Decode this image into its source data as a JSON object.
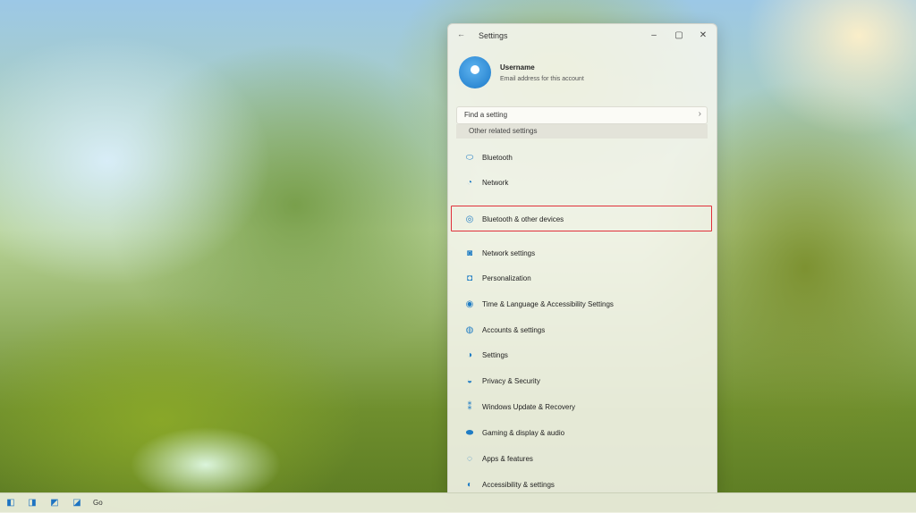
{
  "window": {
    "title": "Settings",
    "back_icon": "back-arrow-icon",
    "controls": [
      "minimize",
      "maximize",
      "close"
    ],
    "control_glyphs": {
      "minimize": "–",
      "maximize": "▢",
      "close": "✕"
    }
  },
  "profile": {
    "name": "Username",
    "email": "Email address for this account",
    "avatar_color": "#1a78c8"
  },
  "find_setting": {
    "label": "Find a setting",
    "chevron": "›"
  },
  "other_settings": {
    "label": "Other related settings"
  },
  "nav_items": [
    {
      "label": "Bluetooth",
      "icon": "bluetooth-icon",
      "glyph": "⬭"
    },
    {
      "label": "Network",
      "icon": "network-icon",
      "glyph": "◔"
    },
    {
      "label": "Bluetooth & other devices",
      "icon": "devices-icon",
      "glyph": "◎",
      "highlighted": true
    },
    {
      "label": "Network settings",
      "icon": "network-settings-icon",
      "glyph": "◙"
    },
    {
      "label": "Personalization",
      "icon": "personalization-icon",
      "glyph": "◘"
    },
    {
      "label": "Time & Language & Accessibility Settings",
      "icon": "time-icon",
      "glyph": "◉"
    },
    {
      "label": "Accounts & settings",
      "icon": "accounts-icon",
      "glyph": "◍"
    },
    {
      "label": "Settings",
      "icon": "settings-icon",
      "glyph": "◑"
    },
    {
      "label": "Privacy & Security",
      "icon": "privacy-icon",
      "glyph": "◒"
    },
    {
      "label": "Windows Update & Recovery",
      "icon": "update-icon",
      "glyph": "⁑"
    },
    {
      "label": "Gaming & display & audio",
      "icon": "gaming-icon",
      "glyph": "⬬"
    },
    {
      "label": "Apps & features",
      "icon": "apps-icon",
      "glyph": "◌"
    },
    {
      "label": "Accessibility & settings",
      "icon": "accessibility-icon",
      "glyph": "◐"
    }
  ],
  "highlight_color": "#e0303a",
  "taskbar": {
    "apps": [
      {
        "icon": "start-icon",
        "glyph": "◧"
      },
      {
        "icon": "file-explorer-icon",
        "glyph": "◨"
      },
      {
        "icon": "folder-icon",
        "glyph": "◩"
      },
      {
        "icon": "edge-icon",
        "glyph": "◪"
      }
    ],
    "label": "Go"
  }
}
